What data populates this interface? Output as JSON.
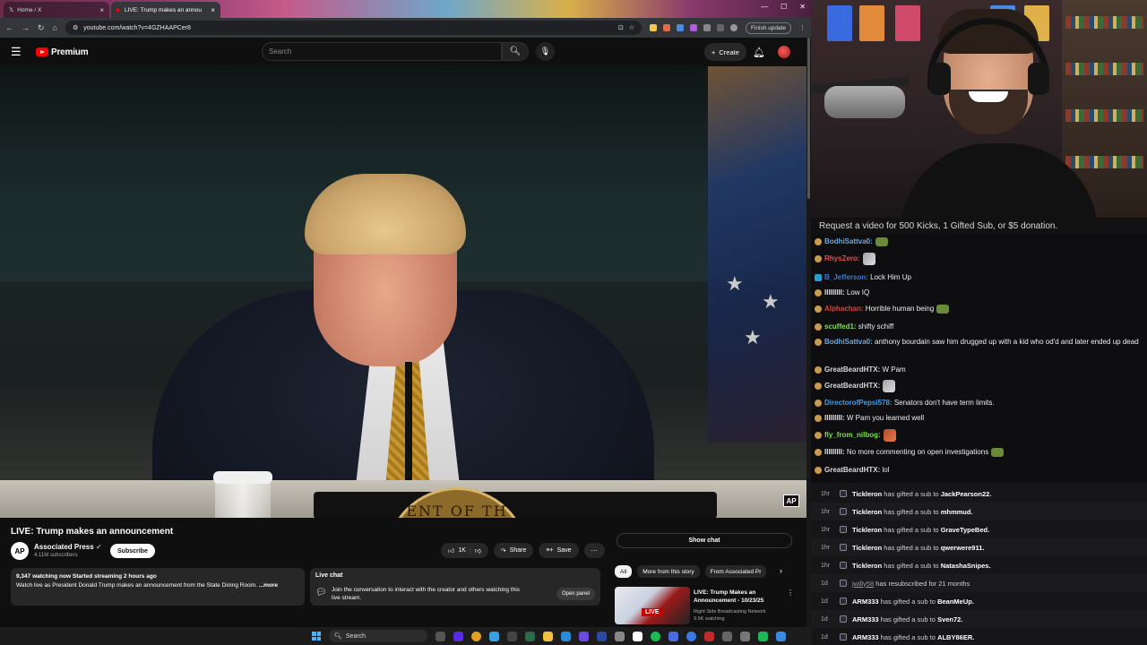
{
  "browser": {
    "tabs": [
      {
        "title": "Home / X"
      },
      {
        "title": "LIVE: Trump makes an annou"
      }
    ],
    "url": "youtube.com/watch?v=4GZHAAPCer8",
    "finish_update": "Finish update"
  },
  "youtube": {
    "logo_text": "Premium",
    "search_placeholder": "Search",
    "create_label": "Create",
    "video_title": "LIVE: Trump makes an announcement",
    "channel_name": "Associated Press",
    "channel_initials": "AP",
    "subscribers": "4.11M subscribers",
    "subscribe_label": "Subscribe",
    "likes": "1K",
    "share_label": "Share",
    "save_label": "Save",
    "watching": "9,347 watching now",
    "started": "Started streaming 2 hours ago",
    "description": "Watch live as President Donald Trump makes an announcement from the State Dining Room.",
    "more_label": "...more",
    "livechat_title": "Live chat",
    "livechat_text": "Join the conversation to interact with the creator and others watching this live stream.",
    "open_panel_label": "Open panel",
    "show_chat_label": "Show chat",
    "chips": [
      "All",
      "More from this story",
      "From Associated Pr"
    ],
    "related": {
      "title": "LIVE: Trump Makes an Announcement - 10/23/25",
      "channel": "Right Side Broadcasting Network",
      "views": "9.5K watching",
      "thumb_label": "LIVE"
    },
    "watermark": "AP",
    "seal_text": "ENT OF TH"
  },
  "taskbar": {
    "search_label": "Search"
  },
  "stream": {
    "request_text": "Request a video for 500 Kicks, 1 Gifted Sub, or $5 donation."
  },
  "chat": [
    {
      "user": "BodhiSattva0:",
      "text": "",
      "color": "#6aa7e0",
      "emote": "frog"
    },
    {
      "user": "RhysZero:",
      "text": "",
      "color": "#e05050",
      "emote": "pic"
    },
    {
      "user": "B_Jefferson:",
      "text": " Lock Him Up",
      "color": "#3a7ad8"
    },
    {
      "user": "IIIIIIIII:",
      "text": " Low IQ",
      "color": "#e0e0e0"
    },
    {
      "user": "Alphachan:",
      "text": " Horrible human being",
      "color": "#e04040",
      "emote": "frog"
    },
    {
      "user": "scuffed1:",
      "text": " shifty schiff",
      "color": "#7ae04a"
    },
    {
      "user": "BodhiSattva0:",
      "text": " anthony bourdain saw him drugged up with a kid who od'd and later ended up dead",
      "color": "#6aa7e0"
    },
    {
      "user": "GreatBeardHTX:",
      "text": " W Pam",
      "color": "#d8d8d8"
    },
    {
      "user": "GreatBeardHTX:",
      "text": "",
      "color": "#d8d8d8",
      "emote": "pic"
    },
    {
      "user": "DirectorofPepsi578:",
      "text": " Senators don't have term limits.",
      "color": "#4a9ae0"
    },
    {
      "user": "IIIIIIIII:",
      "text": " W Pam you learned well",
      "color": "#e0e0e0"
    },
    {
      "user": "fly_from_nilbog:",
      "text": "",
      "color": "#7ae04a",
      "emote": "red"
    },
    {
      "user": "IIIIIIIII:",
      "text": " No more commenting on open investigations",
      "color": "#e0e0e0",
      "emote": "frog"
    },
    {
      "user": "GreatBeardHTX:",
      "text": " lol",
      "color": "#d8d8d8"
    }
  ],
  "events": [
    {
      "time": "1hr",
      "who": "Tickleron",
      "action": " has gifted a sub to ",
      "to": "JackPearson22."
    },
    {
      "time": "1hr",
      "who": "Tickleron",
      "action": " has gifted a sub to ",
      "to": "mhmmud."
    },
    {
      "time": "1hr",
      "who": "Tickleron",
      "action": " has gifted a sub to ",
      "to": "GraveTypeBed."
    },
    {
      "time": "1hr",
      "who": "Tickleron",
      "action": " has gifted a sub to ",
      "to": "qwerwere911."
    },
    {
      "time": "1hr",
      "who": "Tickleron",
      "action": " has gifted a sub to ",
      "to": "NatashaSnipes."
    },
    {
      "time": "1d",
      "who": "jwilly58",
      "action": " has resubscribed for 21 months",
      "to": ""
    },
    {
      "time": "1d",
      "who": "ARM333",
      "action": " has gifted a sub to ",
      "to": "BeanMeUp."
    },
    {
      "time": "1d",
      "who": "ARM333",
      "action": " has gifted a sub to ",
      "to": "Sven72."
    },
    {
      "time": "1d",
      "who": "ARM333",
      "action": " has gifted a sub to ",
      "to": "ALBY86ER."
    }
  ]
}
